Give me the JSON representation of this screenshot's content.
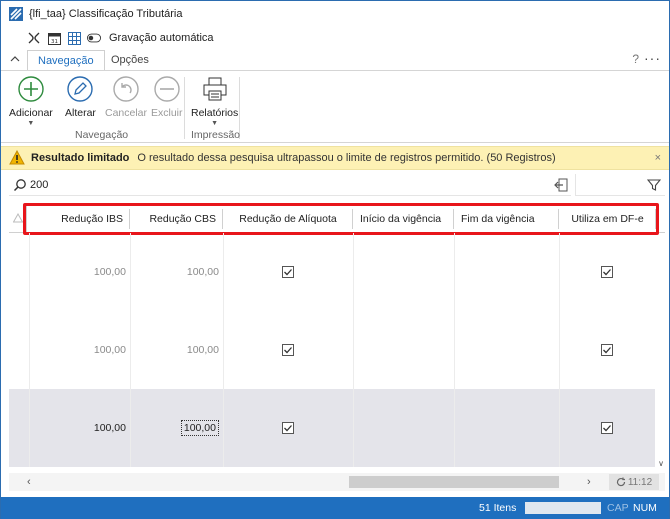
{
  "window": {
    "title": "{lfi_taa}  Classificação Tributária",
    "controls": [
      "–",
      "☐",
      "✕"
    ]
  },
  "qat": {
    "autosave_label": "Gravação automática"
  },
  "ribbon": {
    "tabs": [
      {
        "label": "Navegação",
        "active": true
      },
      {
        "label": "Opções",
        "active": false
      }
    ],
    "help": "?",
    "more": "···",
    "buttons": [
      {
        "label": "Adicionar",
        "enabled": true,
        "dropdown": true
      },
      {
        "label": "Alterar",
        "enabled": true
      },
      {
        "label": "Cancelar",
        "enabled": false
      },
      {
        "label": "Excluir",
        "enabled": false
      },
      {
        "label": "Relatórios",
        "enabled": true,
        "dropdown": true
      }
    ],
    "groups": [
      "Navegação",
      "Impressão"
    ]
  },
  "warning": {
    "title": "Resultado limitado",
    "message": "O resultado dessa pesquisa ultrapassou o limite de registros permitido. (50 Registros)",
    "close": "×"
  },
  "search": {
    "value": "200"
  },
  "grid": {
    "columns": [
      {
        "label": "Redução IBS",
        "align": "right"
      },
      {
        "label": "Redução CBS",
        "align": "right"
      },
      {
        "label": "Redução de Alíquota",
        "align": "center"
      },
      {
        "label": "Início da vigência",
        "align": "left"
      },
      {
        "label": "Fim da vigência",
        "align": "left"
      },
      {
        "label": "Utiliza em DF-e",
        "align": "center"
      }
    ],
    "rows": [
      {
        "reducao_ibs": "100,00",
        "reducao_cbs": "100,00",
        "reducao_aliquota": true,
        "inicio": "",
        "fim": "",
        "utiliza_dfe": true,
        "selected": false
      },
      {
        "reducao_ibs": "100,00",
        "reducao_cbs": "100,00",
        "reducao_aliquota": true,
        "inicio": "",
        "fim": "",
        "utiliza_dfe": true,
        "selected": false
      },
      {
        "reducao_ibs": "100,00",
        "reducao_cbs": "100,00",
        "reducao_aliquota": true,
        "inicio": "",
        "fim": "",
        "utiliza_dfe": true,
        "selected": true
      }
    ]
  },
  "hscroll": {
    "left": "‹",
    "right": "›",
    "refresh_label": "11:12"
  },
  "status": {
    "items": "51 Itens",
    "cap": "CAP",
    "num": "NUM"
  },
  "colors": {
    "accent": "#1f6fbf",
    "highlight_border": "#e8151b",
    "warning_bg": "#fdf1b4"
  }
}
